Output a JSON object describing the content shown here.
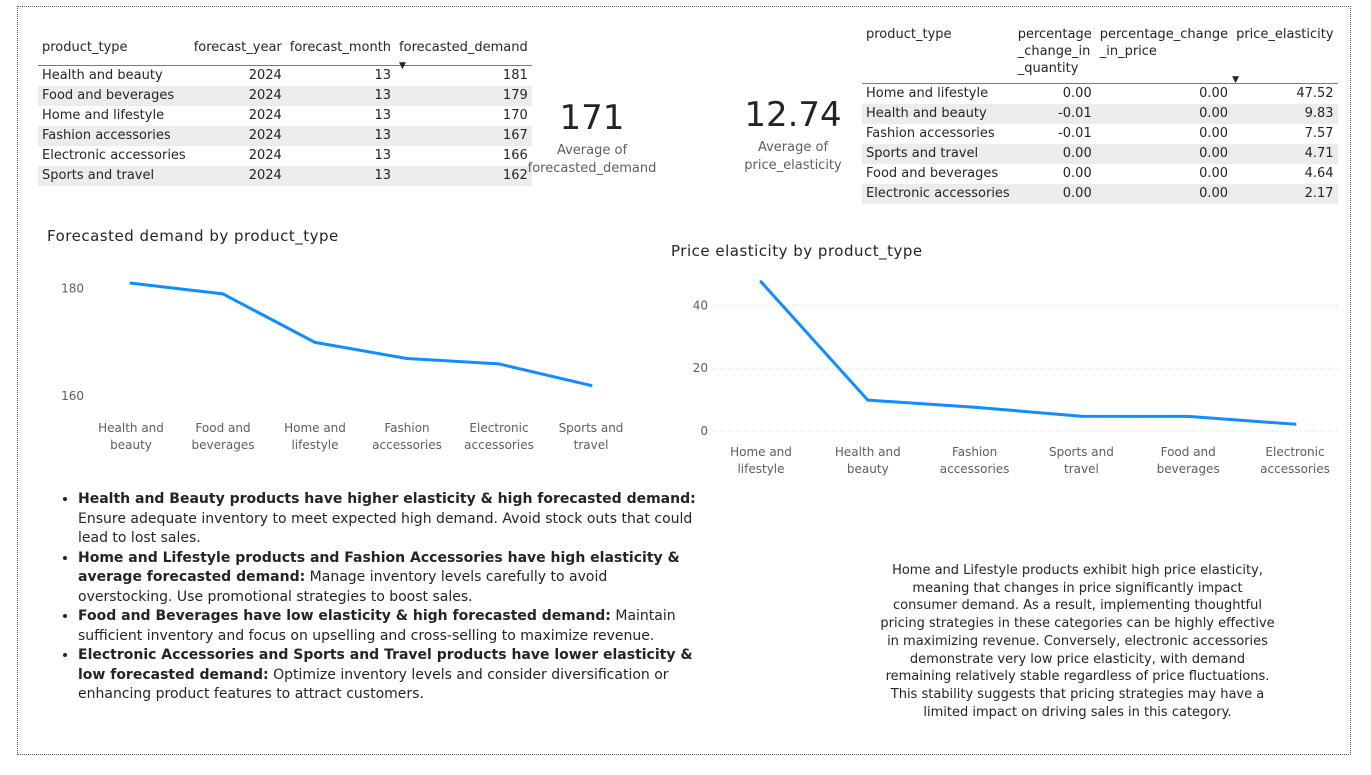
{
  "demand_table": {
    "headers": [
      "product_type",
      "forecast_year",
      "forecast_month",
      "forecasted_demand"
    ],
    "rows": [
      [
        "Health and beauty",
        "2024",
        "13",
        "181"
      ],
      [
        "Food and beverages",
        "2024",
        "13",
        "179"
      ],
      [
        "Home and lifestyle",
        "2024",
        "13",
        "170"
      ],
      [
        "Fashion accessories",
        "2024",
        "13",
        "167"
      ],
      [
        "Electronic accessories",
        "2024",
        "13",
        "166"
      ],
      [
        "Sports and travel",
        "2024",
        "13",
        "162"
      ]
    ]
  },
  "elasticity_table": {
    "headers": [
      "product_type",
      "percentage\n_change_in\n_quantity",
      "percentage_change\n_in_price",
      "price_elasticity"
    ],
    "rows": [
      [
        "Home and lifestyle",
        "0.00",
        "0.00",
        "47.52"
      ],
      [
        "Health and beauty",
        "-0.01",
        "0.00",
        "9.83"
      ],
      [
        "Fashion accessories",
        "-0.01",
        "0.00",
        "7.57"
      ],
      [
        "Sports and travel",
        "0.00",
        "0.00",
        "4.71"
      ],
      [
        "Food and beverages",
        "0.00",
        "0.00",
        "4.64"
      ],
      [
        "Electronic accessories",
        "0.00",
        "0.00",
        "2.17"
      ]
    ]
  },
  "card_demand": {
    "value": "171",
    "label": "Average of forecasted_demand"
  },
  "card_elasticity": {
    "value": "12.74",
    "label": "Average of price_elasticity"
  },
  "chart_data": [
    {
      "type": "line",
      "title": "Forecasted demand by product_type",
      "xlabel": "",
      "ylabel": "",
      "categories": [
        "Health and beauty",
        "Food and beverages",
        "Home and lifestyle",
        "Fashion accessories",
        "Electronic accessories",
        "Sports and travel"
      ],
      "values": [
        181,
        179,
        170,
        167,
        166,
        162
      ],
      "yticks": [
        160,
        180
      ],
      "ylim": [
        158,
        184
      ],
      "grid": false,
      "color": "#118DFF"
    },
    {
      "type": "line",
      "title": "Price elasticity by product_type",
      "xlabel": "",
      "ylabel": "",
      "categories": [
        "Home and lifestyle",
        "Health and beauty",
        "Fashion accessories",
        "Sports and travel",
        "Food and beverages",
        "Electronic accessories"
      ],
      "values": [
        47.52,
        9.83,
        7.57,
        4.71,
        4.64,
        2.17
      ],
      "yticks": [
        0,
        20,
        40
      ],
      "ylim": [
        0,
        50
      ],
      "grid": true,
      "color": "#118DFF"
    }
  ],
  "bullets": [
    {
      "bold": "Health and Beauty products have higher elasticity & high forecasted demand:",
      "text": " Ensure adequate inventory to meet expected high demand. Avoid stock outs that could lead to lost sales."
    },
    {
      "bold": "Home and Lifestyle products and Fashion Accessories have high elasticity & average forecasted demand:",
      "text": " Manage inventory levels carefully to avoid overstocking. Use promotional strategies to boost sales."
    },
    {
      "bold": "Food and Beverages have low elasticity & high forecasted demand:",
      "text": " Maintain sufficient inventory and focus on upselling and cross-selling to maximize revenue."
    },
    {
      "bold": "Electronic Accessories and Sports and Travel products have lower elasticity & low forecasted demand:",
      "text": " Optimize inventory levels and consider diversification or enhancing product features to attract customers."
    }
  ],
  "paragraph": "Home and Lifestyle products exhibit high price elasticity, meaning that changes in price significantly impact consumer demand. As a result, implementing thoughtful pricing strategies in these categories can be highly effective in maximizing revenue. Conversely, electronic accessories demonstrate very low price elasticity, with demand remaining relatively stable regardless of price fluctuations. This stability suggests that pricing strategies may have a limited impact on driving sales in this category."
}
